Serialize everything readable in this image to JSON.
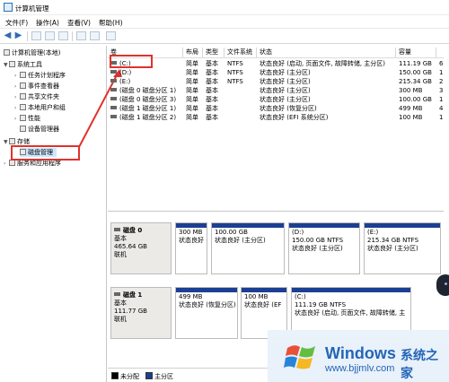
{
  "window": {
    "title": "计算机管理"
  },
  "menu": [
    "文件(F)",
    "操作(A)",
    "查看(V)",
    "帮助(H)"
  ],
  "tree": {
    "root": "计算机管理(本地)",
    "system_tools": "系统工具",
    "items": [
      "任务计划程序",
      "事件查看器",
      "共享文件夹",
      "本地用户和组",
      "性能",
      "设备管理器"
    ],
    "storage": "存储",
    "disk_mgmt": "磁盘管理",
    "services": "服务和应用程序"
  },
  "list": {
    "headers": [
      "卷",
      "布局",
      "类型",
      "文件系统",
      "状态",
      "容量",
      ""
    ],
    "rows": [
      [
        "(C:)",
        "简单",
        "基本",
        "NTFS",
        "状态良好 (启动, 页面文件, 故障转储, 主分区)",
        "111.19 GB",
        "6"
      ],
      [
        "(D:)",
        "简单",
        "基本",
        "NTFS",
        "状态良好 (主分区)",
        "150.00 GB",
        "1"
      ],
      [
        "(E:)",
        "简单",
        "基本",
        "NTFS",
        "状态良好 (主分区)",
        "215.34 GB",
        "2"
      ],
      [
        "(磁盘 0 磁盘分区 1)",
        "简单",
        "基本",
        "",
        "状态良好 (主分区)",
        "300 MB",
        "3"
      ],
      [
        "(磁盘 0 磁盘分区 3)",
        "简单",
        "基本",
        "",
        "状态良好 (主分区)",
        "100.00 GB",
        "1"
      ],
      [
        "(磁盘 1 磁盘分区 1)",
        "简单",
        "基本",
        "",
        "状态良好 (恢复分区)",
        "499 MB",
        "4"
      ],
      [
        "(磁盘 1 磁盘分区 2)",
        "简单",
        "基本",
        "",
        "状态良好 (EFI 系统分区)",
        "100 MB",
        "1"
      ]
    ]
  },
  "disks": [
    {
      "name": "磁盘 0",
      "type": "基本",
      "size": "465.64 GB",
      "status": "联机",
      "parts": [
        {
          "title": "",
          "size": "300 MB",
          "status": "状态良好 (主分区)"
        },
        {
          "title": "",
          "size": "100.00 GB",
          "status": "状态良好 (主分区)"
        },
        {
          "title": "(D:)",
          "size": "150.00 GB NTFS",
          "status": "状态良好 (主分区)"
        },
        {
          "title": "(E:)",
          "size": "215.34 GB NTFS",
          "status": "状态良好 (主分区)"
        }
      ]
    },
    {
      "name": "磁盘 1",
      "type": "基本",
      "size": "111.77 GB",
      "status": "联机",
      "parts": [
        {
          "title": "",
          "size": "499 MB",
          "status": "状态良好 (恢复分区)"
        },
        {
          "title": "",
          "size": "100 MB",
          "status": "状态良好 (EF"
        },
        {
          "title": "(C:)",
          "size": "111.19 GB NTFS",
          "status": "状态良好 (启动, 页面文件, 故障转储, 主"
        }
      ]
    }
  ],
  "legend": {
    "unallocated": "未分配",
    "primary": "主分区"
  },
  "watermark": {
    "brand": "Windows",
    "cn": "系统之家",
    "url": "www.bjjmlv.com"
  },
  "colors": {
    "primary_band": "#1b3f93",
    "selection": "#cde8ff",
    "highlight_red": "#e0322c"
  }
}
